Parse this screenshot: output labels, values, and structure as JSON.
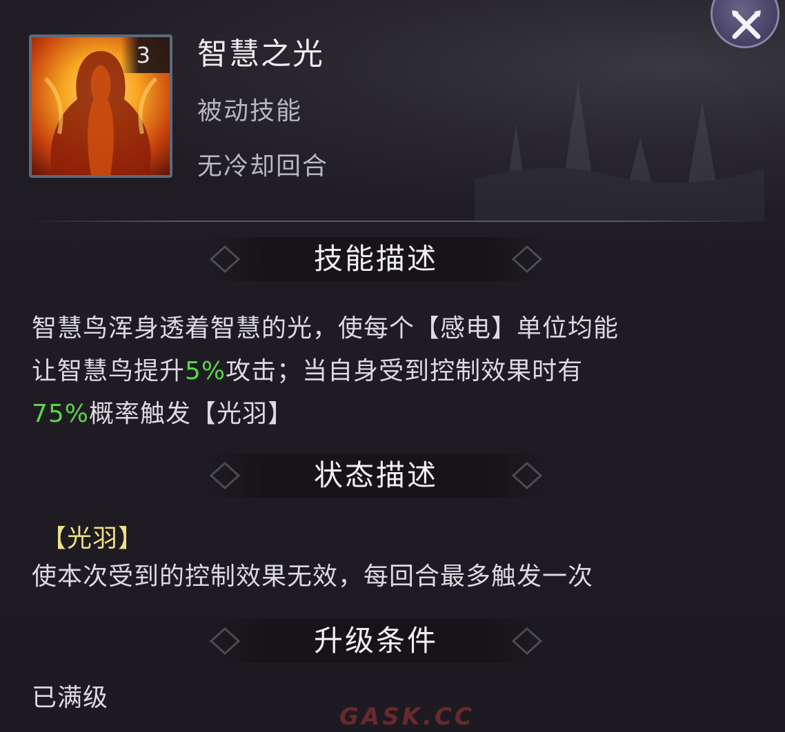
{
  "header": {
    "skill_name": "智慧之光",
    "skill_type": "被动技能",
    "cooldown": "无冷却回合",
    "skill_level": "3"
  },
  "sections": {
    "skill_desc_title": "技能描述",
    "status_desc_title": "状态描述",
    "upgrade_title": "升级条件"
  },
  "skill_description": {
    "line1": "智慧鸟浑身透着智慧的光，使每个【感电】单位均能",
    "line2_a": "让智慧鸟提升",
    "line2_pct": "5%",
    "line2_b": "攻击；当自身受到控制效果时有",
    "line3_pct": "75%",
    "line3_b": "概率触发【光羽】"
  },
  "status": {
    "tag": "【光羽】",
    "text": "使本次受到的控制效果无效，每回合最多触发一次"
  },
  "upgrade": {
    "text": "已满级"
  },
  "watermark": "GASK.CC",
  "colors": {
    "highlight": "#5ad54a",
    "status_tag": "#f0df88"
  }
}
